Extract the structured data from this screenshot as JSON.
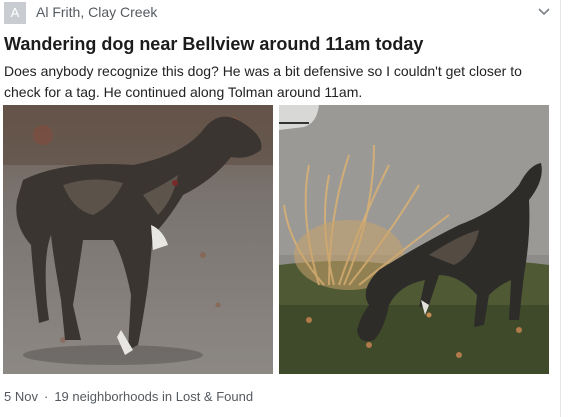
{
  "post": {
    "avatar_letter": "A",
    "author_line": "Al Frith, Clay Creek",
    "title": "Wandering dog near Bellview around 11am today",
    "body": "Does anybody recognize this dog? He was a bit defensive so I couldn't get closer to check for a tag. He continued along Tolman around 11am.",
    "photos": [
      {
        "semantic": "dog-standing-photo"
      },
      {
        "semantic": "dog-sniffing-grass-photo"
      }
    ],
    "date": "5 Nov",
    "separator": "·",
    "audience": "19 neighborhoods in Lost & Found"
  },
  "colors": {
    "avatar_bg": "#c9ccd1",
    "meta_text": "#555a60",
    "title_text": "#1c1c1c"
  }
}
